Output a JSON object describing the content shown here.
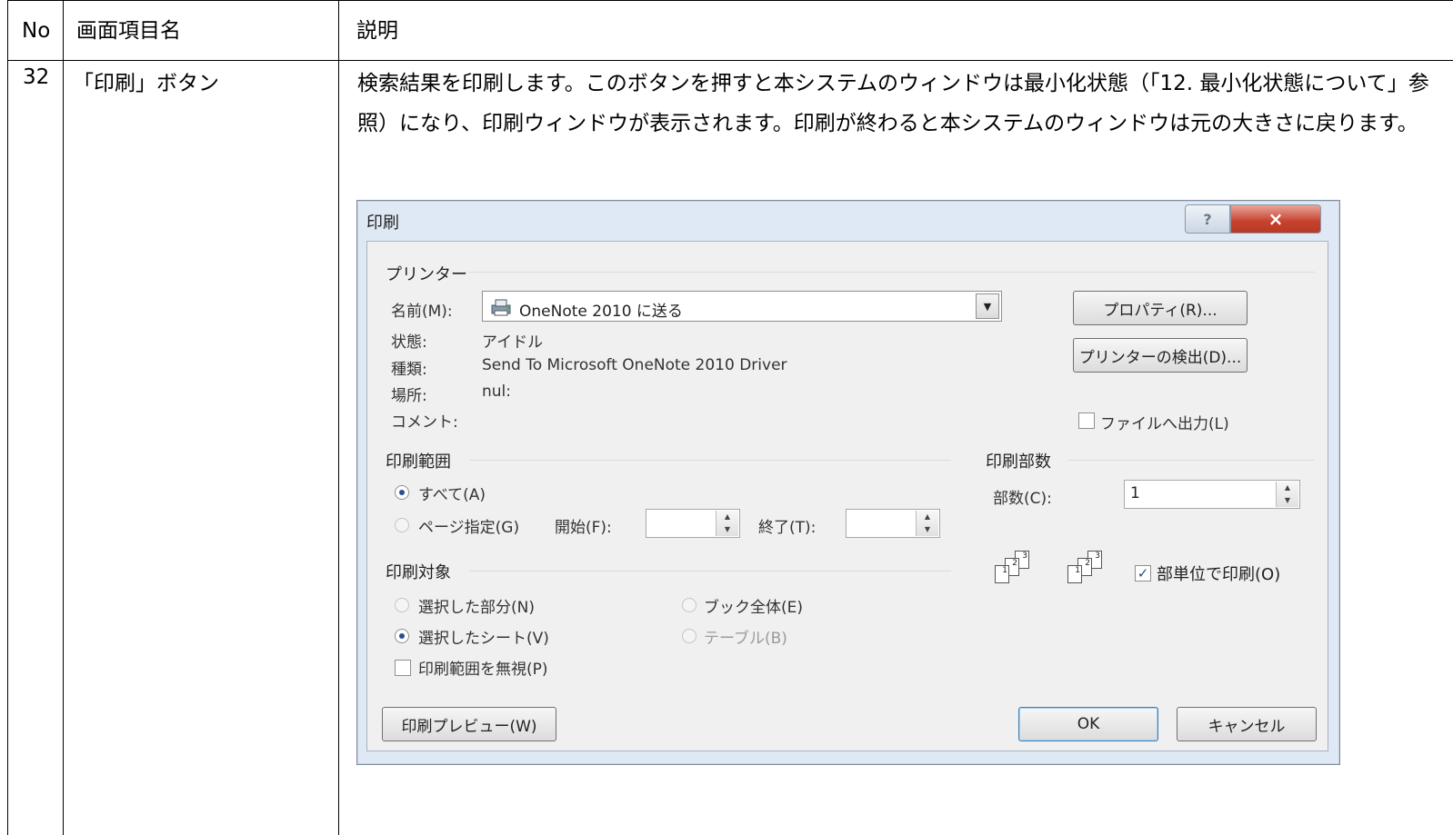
{
  "table": {
    "headers": {
      "no": "No",
      "item": "画面項目名",
      "desc": "説明"
    },
    "row": {
      "no": "32",
      "item": "「印刷」ボタン",
      "desc": "検索結果を印刷します。このボタンを押すと本システムのウィンドウは最小化状態（「12. 最小化状態について」参照）になり、印刷ウィンドウが表示されます。印刷が終わると本システムのウィンドウは元の大きさに戻ります。"
    }
  },
  "dialog": {
    "title": "印刷",
    "help_icon": "?",
    "close_icon": "×",
    "printer": {
      "group_label": "プリンター",
      "name_label": "名前(M):",
      "name_value": "OneNote 2010 に送る",
      "status_label": "状態:",
      "status_value": "アイドル",
      "type_label": "種類:",
      "type_value": "Send To Microsoft OneNote 2010 Driver",
      "location_label": "場所:",
      "location_value": "nul:",
      "comment_label": "コメント:",
      "properties_button": "プロパティ(R)...",
      "find_printer_button": "プリンターの検出(D)...",
      "print_to_file": "ファイルへ出力(L)"
    },
    "range": {
      "group_label": "印刷範囲",
      "all": "すべて(A)",
      "pages": "ページ指定(G)",
      "from_label": "開始(F):",
      "to_label": "終了(T):"
    },
    "copies": {
      "group_label": "印刷部数",
      "count_label": "部数(C):",
      "count_value": "1",
      "collate": "部単位で印刷(O)"
    },
    "target": {
      "group_label": "印刷対象",
      "selection": "選択した部分(N)",
      "entire_workbook": "ブック全体(E)",
      "active_sheets": "選択したシート(V)",
      "table": "テーブル(B)",
      "ignore_print_areas": "印刷範囲を無視(P)"
    },
    "buttons": {
      "preview": "印刷プレビュー(W)",
      "ok": "OK",
      "cancel": "キャンセル"
    }
  }
}
